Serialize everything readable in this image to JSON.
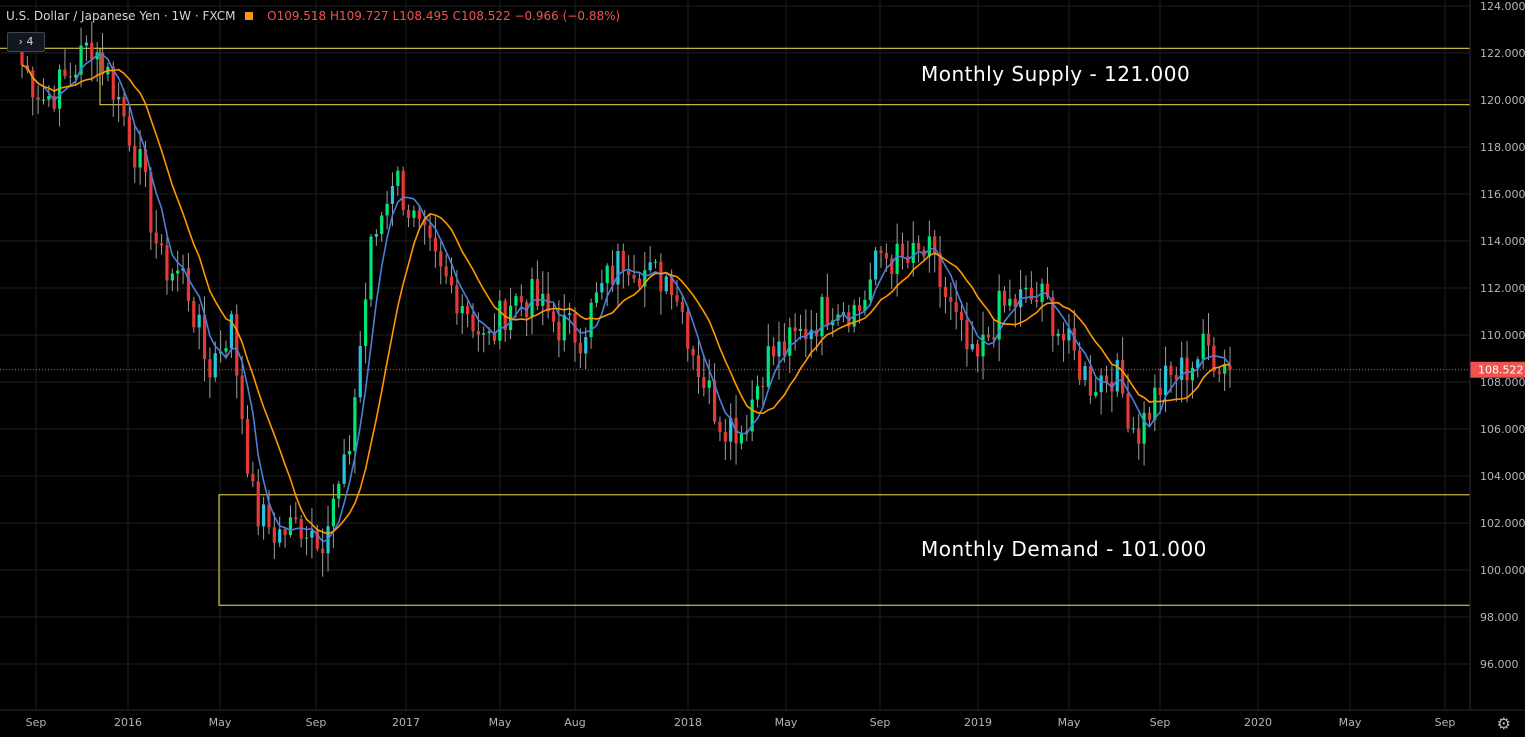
{
  "legend": {
    "symbol": "U.S. Dollar / Japanese Yen",
    "interval": "1W",
    "source": "FXCM",
    "ohlc": "O109.518  H109.727  L108.495  C108.522  −0.966 (−0.88%)"
  },
  "indicator_toggle": "› 4",
  "annotations": {
    "supply": "Monthly Supply - 121.000",
    "demand": "Monthly Demand - 101.000"
  },
  "last_price_label": "108.522",
  "colors": {
    "up": "#00e676",
    "up_alt": "#26c6da",
    "down": "#e53935",
    "ma_fast": "#4a7fdc",
    "ma_slow": "#ff9800",
    "zone": "#f4e04d",
    "grid": "#1e1e1e",
    "last_price": "#ef5350"
  },
  "chart_data": {
    "type": "candlestick",
    "title": "U.S. Dollar / Japanese Yen · 1W · FXCM",
    "ylim": [
      95,
      124
    ],
    "y_ticks": [
      "124.000",
      "122.000",
      "120.000",
      "118.000",
      "116.000",
      "114.000",
      "112.000",
      "110.000",
      "108.000",
      "106.000",
      "104.000",
      "102.000",
      "100.000",
      "98.000",
      "96.000"
    ],
    "x_ticks": [
      "Sep",
      "2016",
      "May",
      "Sep",
      "2017",
      "May",
      "Aug",
      "2018",
      "May",
      "Sep",
      "2019",
      "May",
      "Sep",
      "2020",
      "May",
      "Sep"
    ],
    "zones": [
      {
        "name": "Monthly Supply",
        "from_tick": "Nov 2015",
        "upper": 122.2,
        "lower": 119.8
      },
      {
        "name": "Monthly Demand",
        "from_tick": "May 2016",
        "upper": 103.2,
        "lower": 98.5
      }
    ],
    "last_price": 108.522,
    "close_path": [
      [
        "Aug 2015",
        121.5
      ],
      [
        "Sep 2015",
        120.0
      ],
      [
        "Oct 2015",
        121.0
      ],
      [
        "Nov 2015",
        122.5
      ],
      [
        "Dec 2015",
        120.5
      ],
      [
        "Jan 2016",
        117.5
      ],
      [
        "Feb 2016",
        113.0
      ],
      [
        "Mar 2016",
        112.5
      ],
      [
        "Apr 2016",
        108.5
      ],
      [
        "May 2016",
        110.5
      ],
      [
        "Jun 2016",
        102.5
      ],
      [
        "Jul 2016",
        101.5
      ],
      [
        "Aug 2016",
        102.0
      ],
      [
        "Sep 2016",
        101.5
      ],
      [
        "Oct 2016",
        104.5
      ],
      [
        "Nov 2016",
        113.5
      ],
      [
        "Dec 2016",
        117.0
      ],
      [
        "Jan 2017",
        114.5
      ],
      [
        "Feb 2017",
        112.5
      ],
      [
        "Mar 2017",
        111.5
      ],
      [
        "Apr 2017",
        109.5
      ],
      [
        "May 2017",
        111.5
      ],
      [
        "Jun 2017",
        111.5
      ],
      [
        "Jul 2017",
        110.5
      ],
      [
        "Aug 2017",
        110.0
      ],
      [
        "Sep 2017",
        112.0
      ],
      [
        "Oct 2017",
        113.5
      ],
      [
        "Nov 2017",
        112.5
      ],
      [
        "Dec 2017",
        112.5
      ],
      [
        "Jan 2018",
        109.0
      ],
      [
        "Feb 2018",
        106.5
      ],
      [
        "Mar 2018",
        106.0
      ],
      [
        "Apr 2018",
        109.0
      ],
      [
        "May 2018",
        109.5
      ],
      [
        "Jun 2018",
        110.5
      ],
      [
        "Jul 2018",
        111.5
      ],
      [
        "Aug 2018",
        111.0
      ],
      [
        "Sep 2018",
        113.5
      ],
      [
        "Oct 2018",
        113.0
      ],
      [
        "Nov 2018",
        113.5
      ],
      [
        "Dec 2018",
        111.0
      ],
      [
        "Jan 2019",
        108.5
      ],
      [
        "Feb 2019",
        111.0
      ],
      [
        "Mar 2019",
        111.5
      ],
      [
        "Apr 2019",
        111.5
      ],
      [
        "May 2019",
        109.5
      ],
      [
        "Jun 2019",
        108.0
      ],
      [
        "Jul 2019",
        108.5
      ],
      [
        "Aug 2019",
        105.8
      ],
      [
        "Sep 2019",
        107.8
      ],
      [
        "Oct 2019",
        108.5
      ],
      [
        "Nov 2019",
        109.5
      ],
      [
        "Dec 2019",
        108.5
      ]
    ],
    "series": [
      {
        "name": "MA (fast)",
        "color": "#4a7fdc"
      },
      {
        "name": "MA (slow)",
        "color": "#ff9800"
      }
    ]
  }
}
